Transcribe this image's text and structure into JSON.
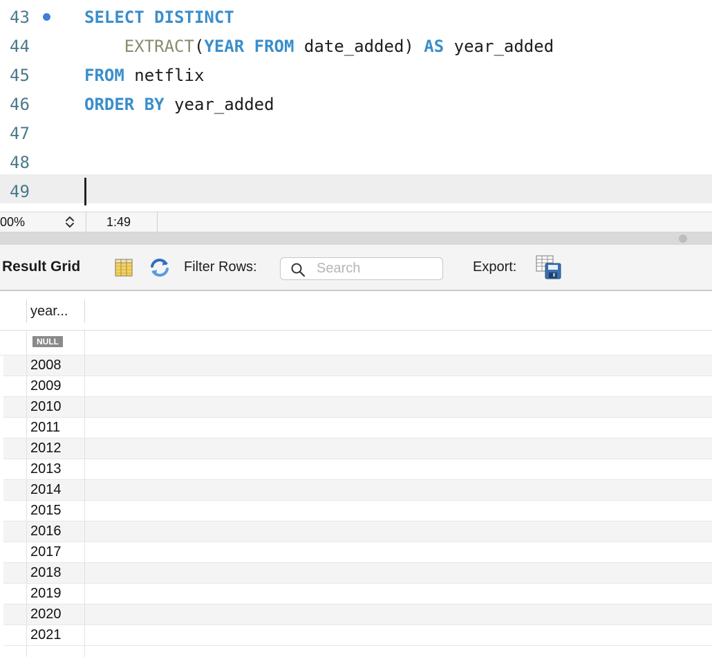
{
  "editor": {
    "lines": [
      {
        "number": "43",
        "breakpoint": true,
        "tokens": [
          {
            "t": "SELECT",
            "c": "kw"
          },
          {
            "t": " ",
            "c": "punct"
          },
          {
            "t": "DISTINCT",
            "c": "kw"
          }
        ]
      },
      {
        "number": "44",
        "breakpoint": false,
        "tokens": [
          {
            "t": "    ",
            "c": "punct"
          },
          {
            "t": "EXTRACT",
            "c": "fn"
          },
          {
            "t": "(",
            "c": "punct"
          },
          {
            "t": "YEAR",
            "c": "kw"
          },
          {
            "t": " ",
            "c": "punct"
          },
          {
            "t": "FROM",
            "c": "kw"
          },
          {
            "t": " date_added) ",
            "c": "ident"
          },
          {
            "t": "AS",
            "c": "kw"
          },
          {
            "t": " year_added",
            "c": "ident"
          }
        ]
      },
      {
        "number": "45",
        "breakpoint": false,
        "tokens": [
          {
            "t": "FROM",
            "c": "kw"
          },
          {
            "t": " netflix",
            "c": "ident"
          }
        ]
      },
      {
        "number": "46",
        "breakpoint": false,
        "tokens": [
          {
            "t": "ORDER",
            "c": "kw"
          },
          {
            "t": " ",
            "c": "punct"
          },
          {
            "t": "BY",
            "c": "kw"
          },
          {
            "t": " year_added",
            "c": "ident"
          }
        ]
      },
      {
        "number": "47",
        "breakpoint": false,
        "tokens": []
      },
      {
        "number": "48",
        "breakpoint": false,
        "tokens": []
      },
      {
        "number": "49",
        "breakpoint": false,
        "tokens": [],
        "current": true
      }
    ]
  },
  "status": {
    "zoom": "00%",
    "cursor_position": "1:49"
  },
  "result_toolbar": {
    "title": "Result Grid",
    "filter_label": "Filter Rows:",
    "search_placeholder": "Search",
    "search_value": "",
    "export_label": "Export:",
    "icons": [
      "grid-layout-icon",
      "refresh-icon",
      "search-icon",
      "export-icon"
    ]
  },
  "grid": {
    "columns": [
      "year..."
    ],
    "rows": [
      "NULL",
      "2008",
      "2009",
      "2010",
      "2011",
      "2012",
      "2013",
      "2014",
      "2015",
      "2016",
      "2017",
      "2018",
      "2019",
      "2020",
      "2021"
    ]
  },
  "colors": {
    "keyword": "#3a8ecb",
    "function": "#8a8a6c",
    "line_number": "#4a7a8c",
    "breakpoint": "#3f7fd8"
  }
}
